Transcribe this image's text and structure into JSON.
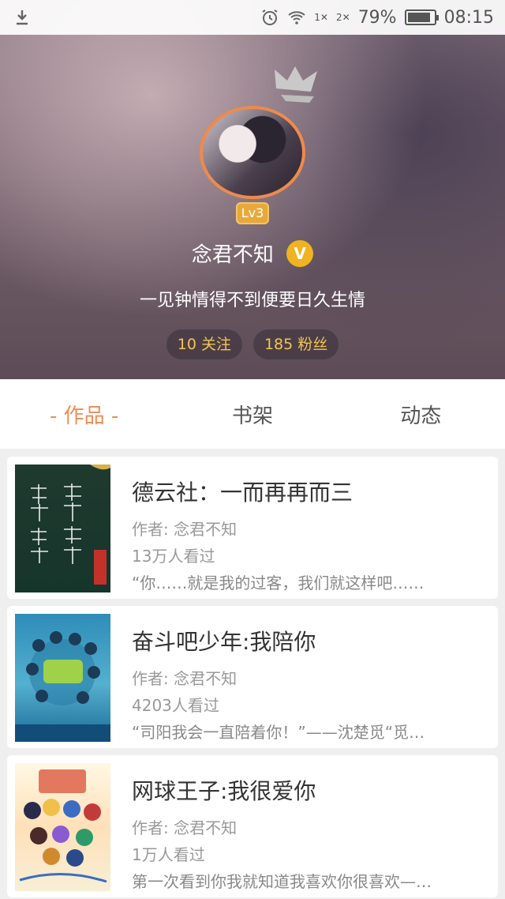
{
  "status_bar": {
    "battery": "79%",
    "time": "08:15",
    "sim1": "1",
    "sim2": "2"
  },
  "profile": {
    "level": "Lv3",
    "name": "念君不知",
    "vip_label": "V",
    "bio": "一见钟情得不到便要日久生情",
    "following": "10 关注",
    "followers": "185 粉丝"
  },
  "tabs": [
    {
      "label": "- 作品 -",
      "active": true
    },
    {
      "label": "书架",
      "active": false
    },
    {
      "label": "动态",
      "active": false
    }
  ],
  "works": [
    {
      "title": "德云社：一而再再而三",
      "author": "作者: 念君不知",
      "views": "13万人看过",
      "excerpt": "“你……就是我的过客，我们就这样吧……”…"
    },
    {
      "title": "奋斗吧少年:我陪你",
      "author": "作者: 念君不知",
      "views": "4203人看过",
      "excerpt": "“司阳我会一直陪着你！”——沈楚觅“觅儿…"
    },
    {
      "title": "网球王子:我很爱你",
      "author": "作者: 念君不知",
      "views": "1万人看过",
      "excerpt": "第一次看到你我就知道我喜欢你很喜欢——手…"
    }
  ],
  "colors": {
    "accent": "#f08c55",
    "badge": "#e8a93a",
    "stat_text": "#f3c451"
  }
}
